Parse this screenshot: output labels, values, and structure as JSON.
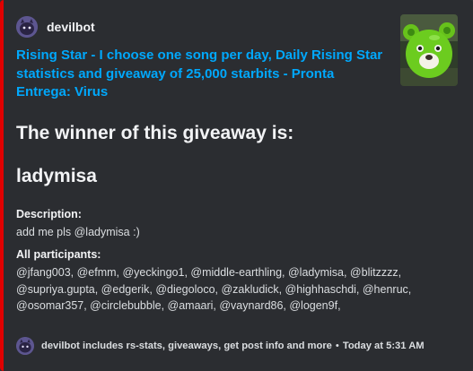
{
  "embed": {
    "accent_color": "#e00000",
    "author": {
      "name": "devilbot",
      "avatar_icon": "devil-avatar-icon"
    },
    "title": "Rising Star - I choose one song per day,  Daily Rising Star statistics and giveaway of 25,000 starbits  - Pronta Entrega: Virus",
    "thumbnail_icon": "green-teddy-bear-thumbnail",
    "heading_winner_label": "The winner of this giveaway is:",
    "heading_winner_name": "ladymisa",
    "fields": {
      "description_name": "Description:",
      "description_value": "add me pls @ladymisa :)",
      "participants_name": "All participants:",
      "participants_value": "@jfang003, @efmm, @yeckingo1, @middle-earthling, @ladymisa, @blitzzzz, @supriya.gupta, @edgerik, @diegoloco, @zakludick, @highhaschdi, @henruc, @osomar357, @circlebubble, @amaari, @vaynard86, @logen9f,"
    },
    "footer": {
      "text": "devilbot includes rs-stats, giveaways, get post info and more",
      "separator": "•",
      "timestamp": "Today at 5:31 AM"
    }
  }
}
